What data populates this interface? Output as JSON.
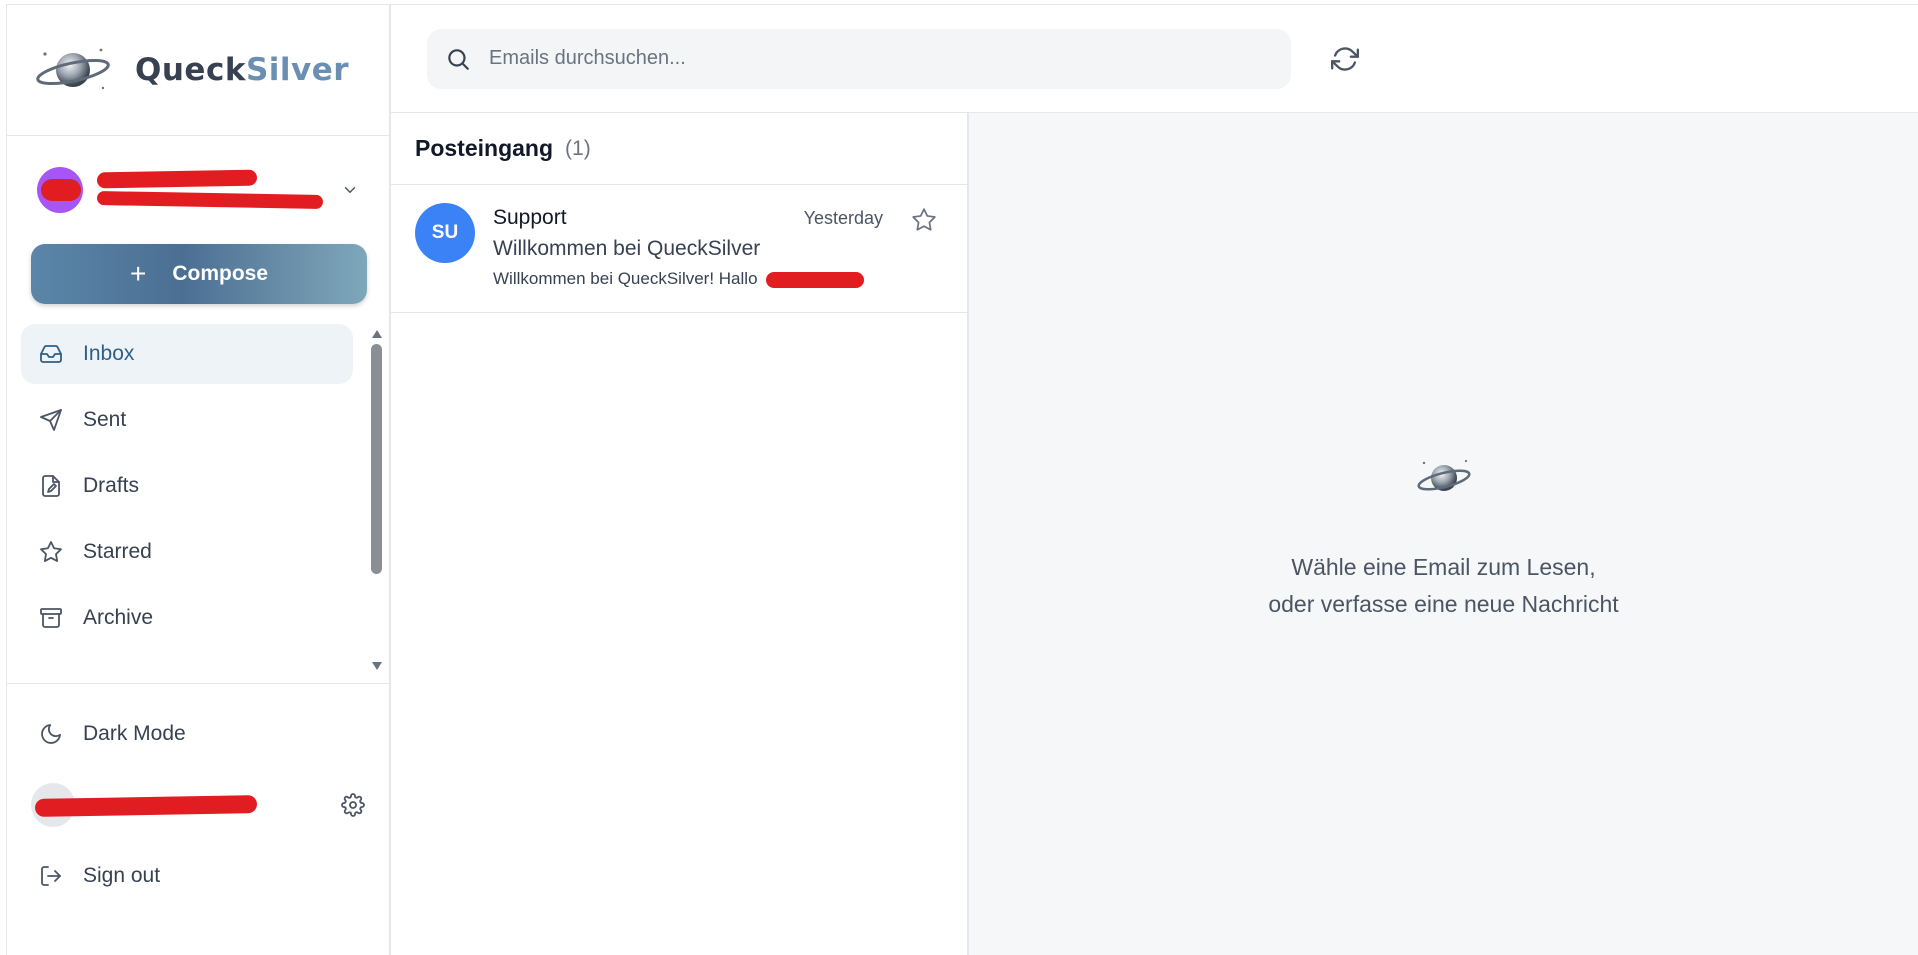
{
  "brand": {
    "name_part1": "Queck",
    "name_part2": "Silver",
    "logo_icon": "planet-icon"
  },
  "account": {
    "avatar_color": "#a855f7"
  },
  "compose": {
    "label": "Compose",
    "icon": "plus-icon"
  },
  "nav": {
    "items": [
      {
        "label": "Inbox",
        "icon": "inbox-icon",
        "active": true
      },
      {
        "label": "Sent",
        "icon": "send-icon",
        "active": false
      },
      {
        "label": "Drafts",
        "icon": "drafts-icon",
        "active": false
      },
      {
        "label": "Starred",
        "icon": "star-icon",
        "active": false
      },
      {
        "label": "Archive",
        "icon": "archive-icon",
        "active": false
      }
    ]
  },
  "bottom": {
    "dark_mode_label": "Dark Mode",
    "sign_out_label": "Sign out"
  },
  "search": {
    "placeholder": "Emails durchsuchen..."
  },
  "list": {
    "title": "Posteingang",
    "count": "(1)",
    "emails": [
      {
        "avatar": "SU",
        "sender": "Support",
        "time": "Yesterday",
        "subject": "Willkommen bei QueckSilver",
        "preview": "Willkommen bei QueckSilver! Hallo"
      }
    ]
  },
  "reading": {
    "empty_line1": "Wähle eine Email zum Lesen,",
    "empty_line2": "oder verfasse eine neue Nachricht"
  },
  "colors": {
    "accent": "#2f5f86",
    "email_avatar": "#3b82f6",
    "redaction": "#e11d21"
  }
}
